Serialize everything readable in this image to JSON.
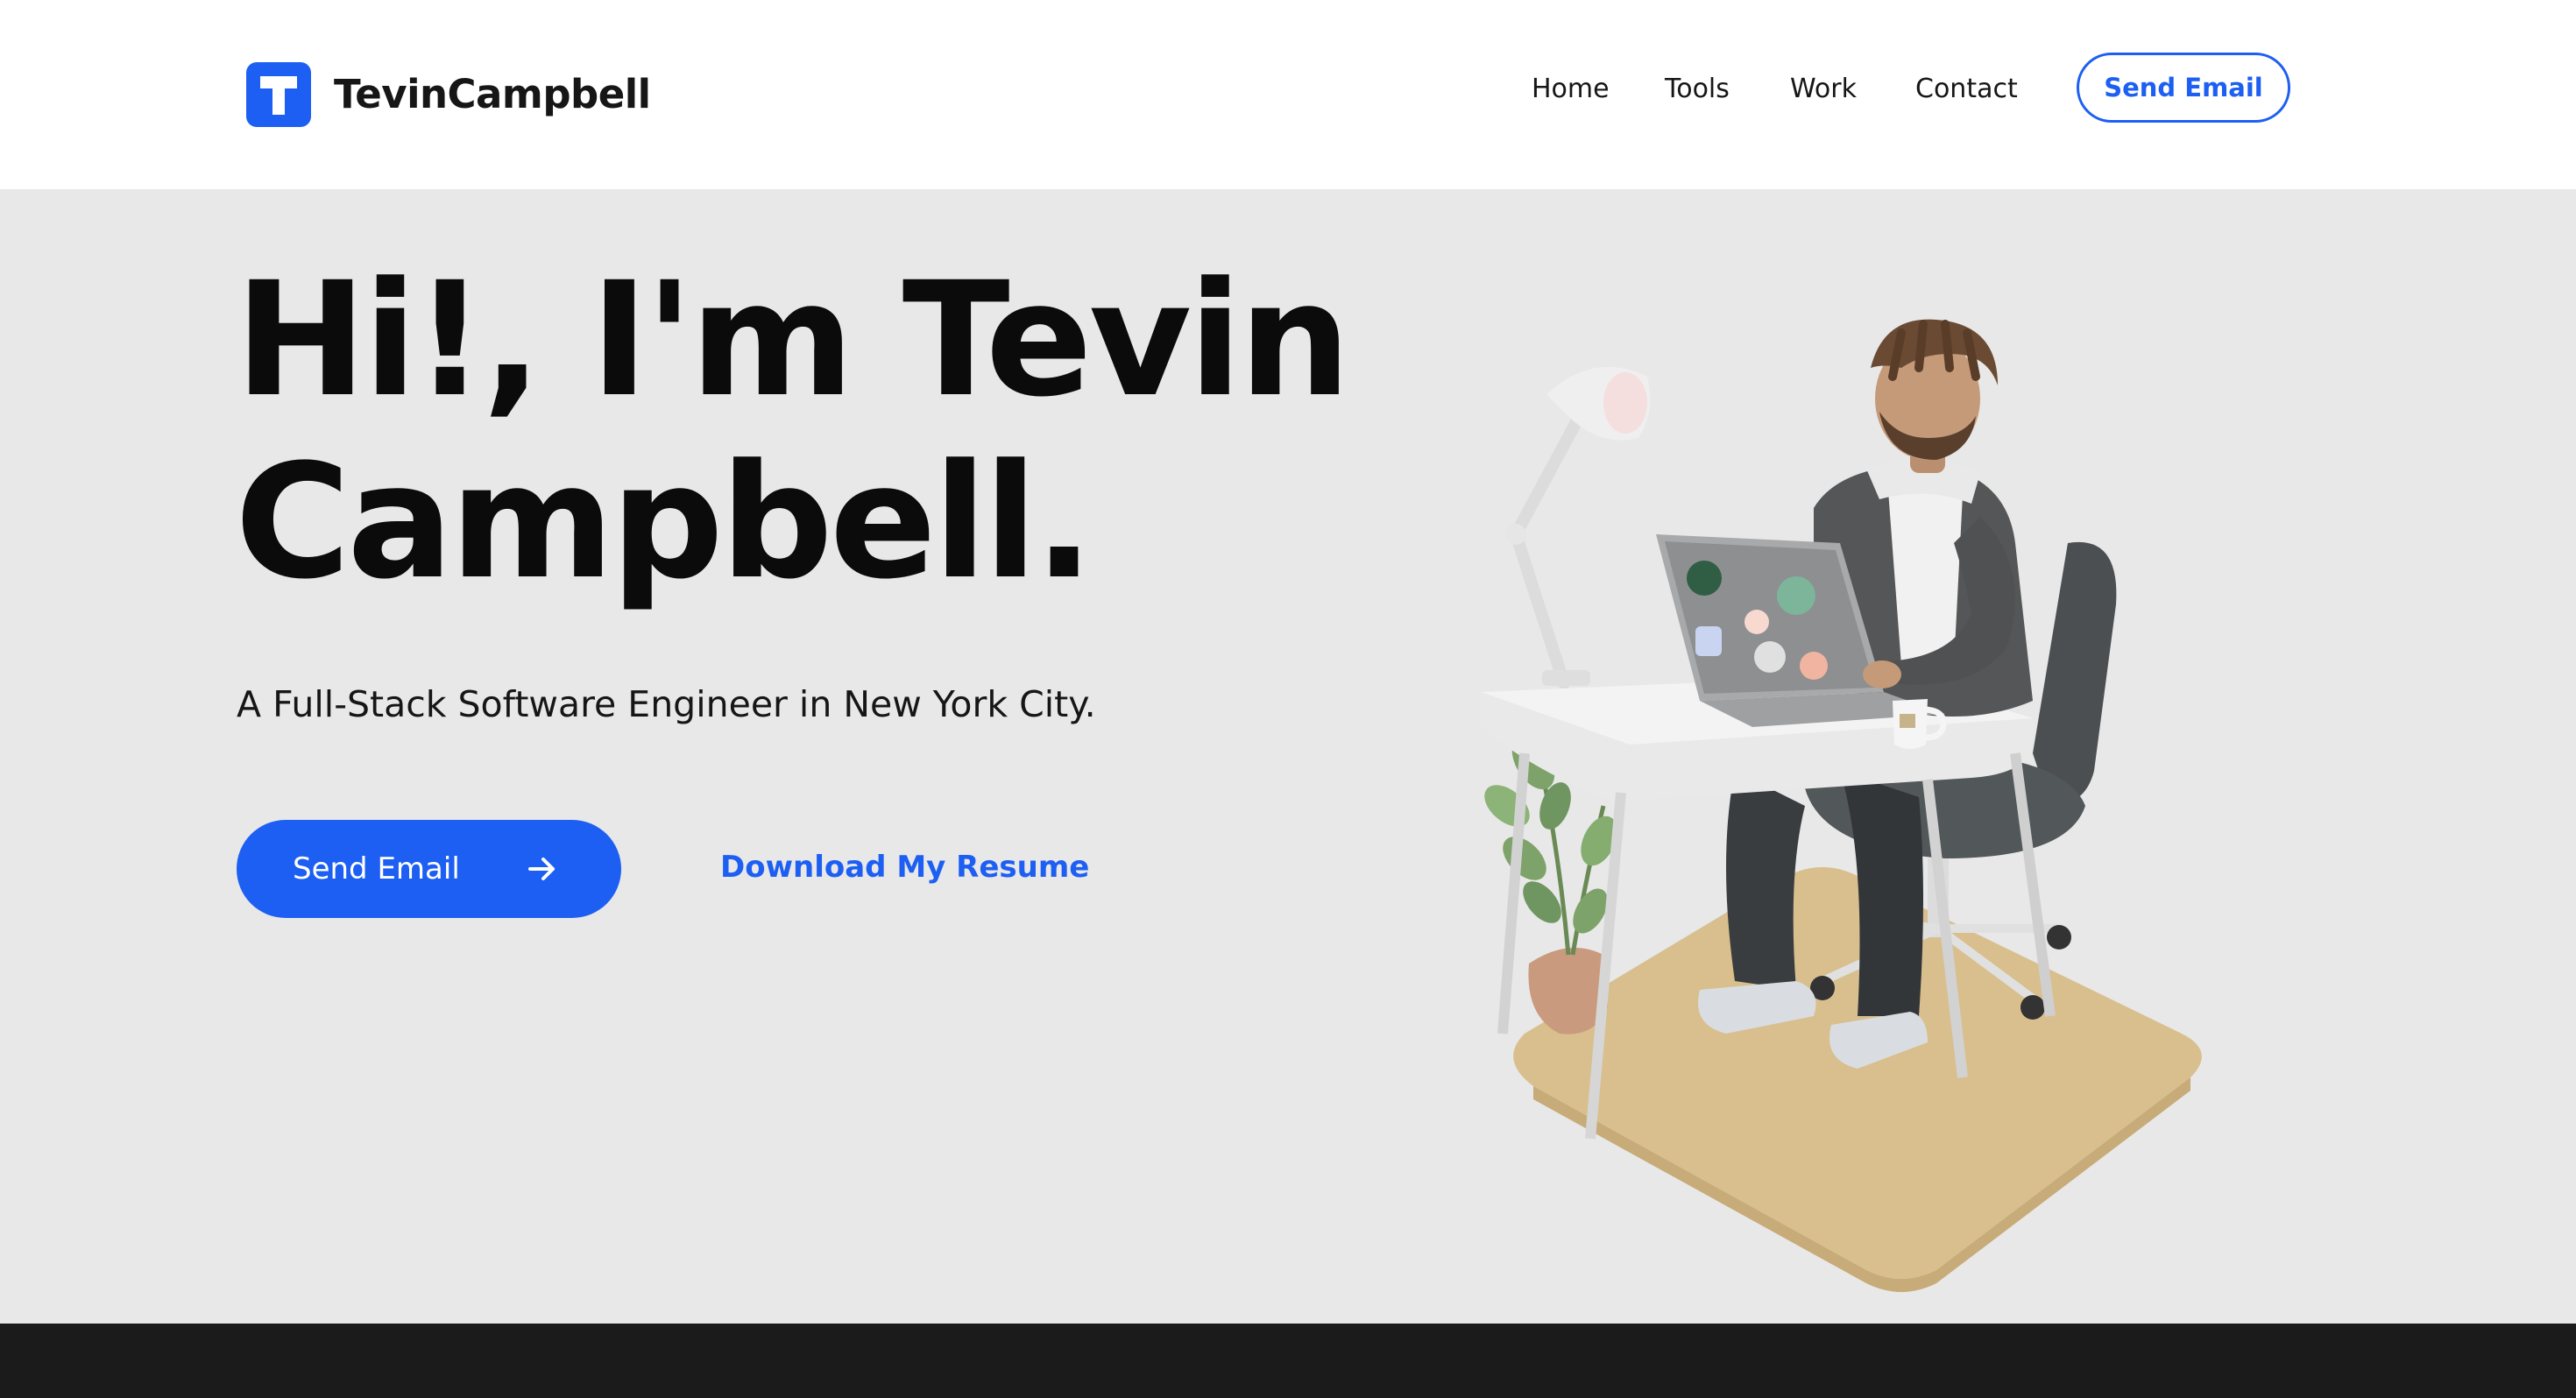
{
  "header": {
    "brand": "TevinCampbell",
    "logo_letter": "T",
    "nav": {
      "home": "Home",
      "tools": "Tools",
      "work": "Work",
      "contact": "Contact"
    },
    "send_email": "Send Email"
  },
  "hero": {
    "headline_line1": "Hi!, I'm Tevin",
    "headline_line2": "Campbell.",
    "subtitle": "A Full-Stack Software Engineer in New York City.",
    "cta_label": "Send Email",
    "cta_icon": "arrow-right-icon",
    "resume_link": "Download My Resume"
  },
  "colors": {
    "accent": "#1d5ff2",
    "hero_bg": "#e8e8e8",
    "text": "#0b0b0b",
    "footer": "#1b1b1b"
  }
}
